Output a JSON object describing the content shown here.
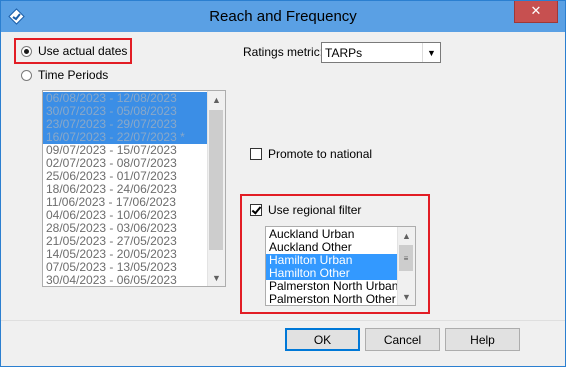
{
  "window": {
    "title": "Reach and Frequency",
    "close_glyph": "✕",
    "title_bar_color": "#5aa0e4",
    "close_button_color": "#c75050"
  },
  "date_mode": {
    "options": [
      "Use actual dates",
      "Time Periods"
    ],
    "selected": "Use actual dates"
  },
  "periods": {
    "items": [
      {
        "label": "06/08/2023 - 12/08/2023",
        "selected": true
      },
      {
        "label": "30/07/2023 - 05/08/2023",
        "selected": true
      },
      {
        "label": "23/07/2023 - 29/07/2023",
        "selected": true
      },
      {
        "label": "16/07/2023 - 22/07/2023 *",
        "selected": true
      },
      {
        "label": "09/07/2023 - 15/07/2023",
        "selected": false
      },
      {
        "label": "02/07/2023 - 08/07/2023",
        "selected": false
      },
      {
        "label": "25/06/2023 - 01/07/2023",
        "selected": false
      },
      {
        "label": "18/06/2023 - 24/06/2023",
        "selected": false
      },
      {
        "label": "11/06/2023 - 17/06/2023",
        "selected": false
      },
      {
        "label": "04/06/2023 - 10/06/2023",
        "selected": false
      },
      {
        "label": "28/05/2023 - 03/06/2023",
        "selected": false
      },
      {
        "label": "21/05/2023 - 27/05/2023",
        "selected": false
      },
      {
        "label": "14/05/2023 - 20/05/2023",
        "selected": false
      },
      {
        "label": "07/05/2023 - 13/05/2023",
        "selected": false
      },
      {
        "label": "30/04/2023 - 06/05/2023",
        "selected": false
      }
    ]
  },
  "ratings": {
    "label": "Ratings metric:",
    "value": "TARPs"
  },
  "promote": {
    "label": "Promote to national",
    "checked": false
  },
  "regional": {
    "label": "Use regional filter",
    "checked": true,
    "items": [
      {
        "label": "Auckland Urban",
        "selected": false
      },
      {
        "label": "Auckland Other",
        "selected": false
      },
      {
        "label": "Hamilton Urban",
        "selected": true
      },
      {
        "label": "Hamilton Other",
        "selected": true
      },
      {
        "label": "Palmerston North Urban",
        "selected": false
      },
      {
        "label": "Palmerston North Other",
        "selected": false
      }
    ]
  },
  "buttons": {
    "ok": "OK",
    "cancel": "Cancel",
    "help": "Help"
  },
  "colors": {
    "highlight_border": "#e21d25",
    "selection": "#3399ff"
  }
}
